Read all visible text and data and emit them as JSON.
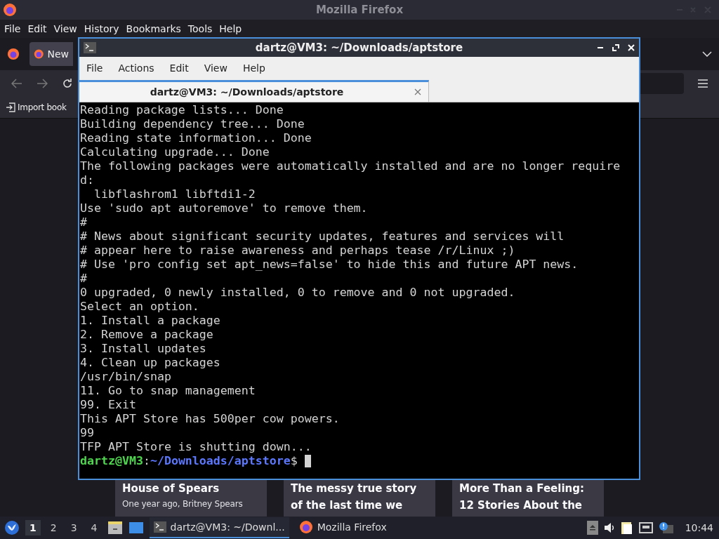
{
  "firefox": {
    "title": "Mozilla Firefox",
    "menu": [
      "File",
      "Edit",
      "View",
      "History",
      "Bookmarks",
      "Tools",
      "Help"
    ],
    "tab": "New",
    "bookmark": "Import book",
    "cards": [
      {
        "title": "House of Spears",
        "text": "One year ago, Britney Spears"
      },
      {
        "title": "The messy true story of the last time we"
      },
      {
        "title": "More Than a Feeling: 12 Stories About the"
      }
    ]
  },
  "terminal": {
    "title": "dartz@VM3: ~/Downloads/aptstore",
    "menu": [
      "File",
      "Actions",
      "Edit",
      "View",
      "Help"
    ],
    "tab": "dartz@VM3: ~/Downloads/aptstore",
    "lines": [
      "Reading package lists... Done",
      "Building dependency tree... Done",
      "Reading state information... Done",
      "Calculating upgrade... Done",
      "The following packages were automatically installed and are no longer require",
      "d:",
      "  libflashrom1 libftdi1-2",
      "Use 'sudo apt autoremove' to remove them.",
      "#",
      "# News about significant security updates, features and services will",
      "# appear here to raise awareness and perhaps tease /r/Linux ;)",
      "# Use 'pro config set apt_news=false' to hide this and future APT news.",
      "#",
      "0 upgraded, 0 newly installed, 0 to remove and 0 not upgraded.",
      "Select an option.",
      "1. Install a package",
      "2. Remove a package",
      "3. Install updates",
      "4. Clean up packages",
      "/usr/bin/snap",
      "11. Go to snap management",
      "99. Exit",
      "This APT Store has 500per cow powers.",
      "99",
      "TFP APT Store is shutting down..."
    ],
    "prompt": {
      "user_host": "dartz@VM3",
      "separator": ":",
      "path": "~/Downloads/aptstore",
      "symbol": "$"
    }
  },
  "taskbar": {
    "workspaces": [
      {
        "label": "1",
        "selected": true
      },
      {
        "label": "2",
        "selected": false
      },
      {
        "label": "3",
        "selected": false
      },
      {
        "label": "4",
        "selected": false
      }
    ],
    "tasks": [
      {
        "kind": "terminal",
        "label": "dartz@VM3: ~/Downl...",
        "selected": true
      },
      {
        "kind": "firefox",
        "label": "Mozilla Firefox",
        "selected": false
      }
    ],
    "clock": "10:44"
  }
}
